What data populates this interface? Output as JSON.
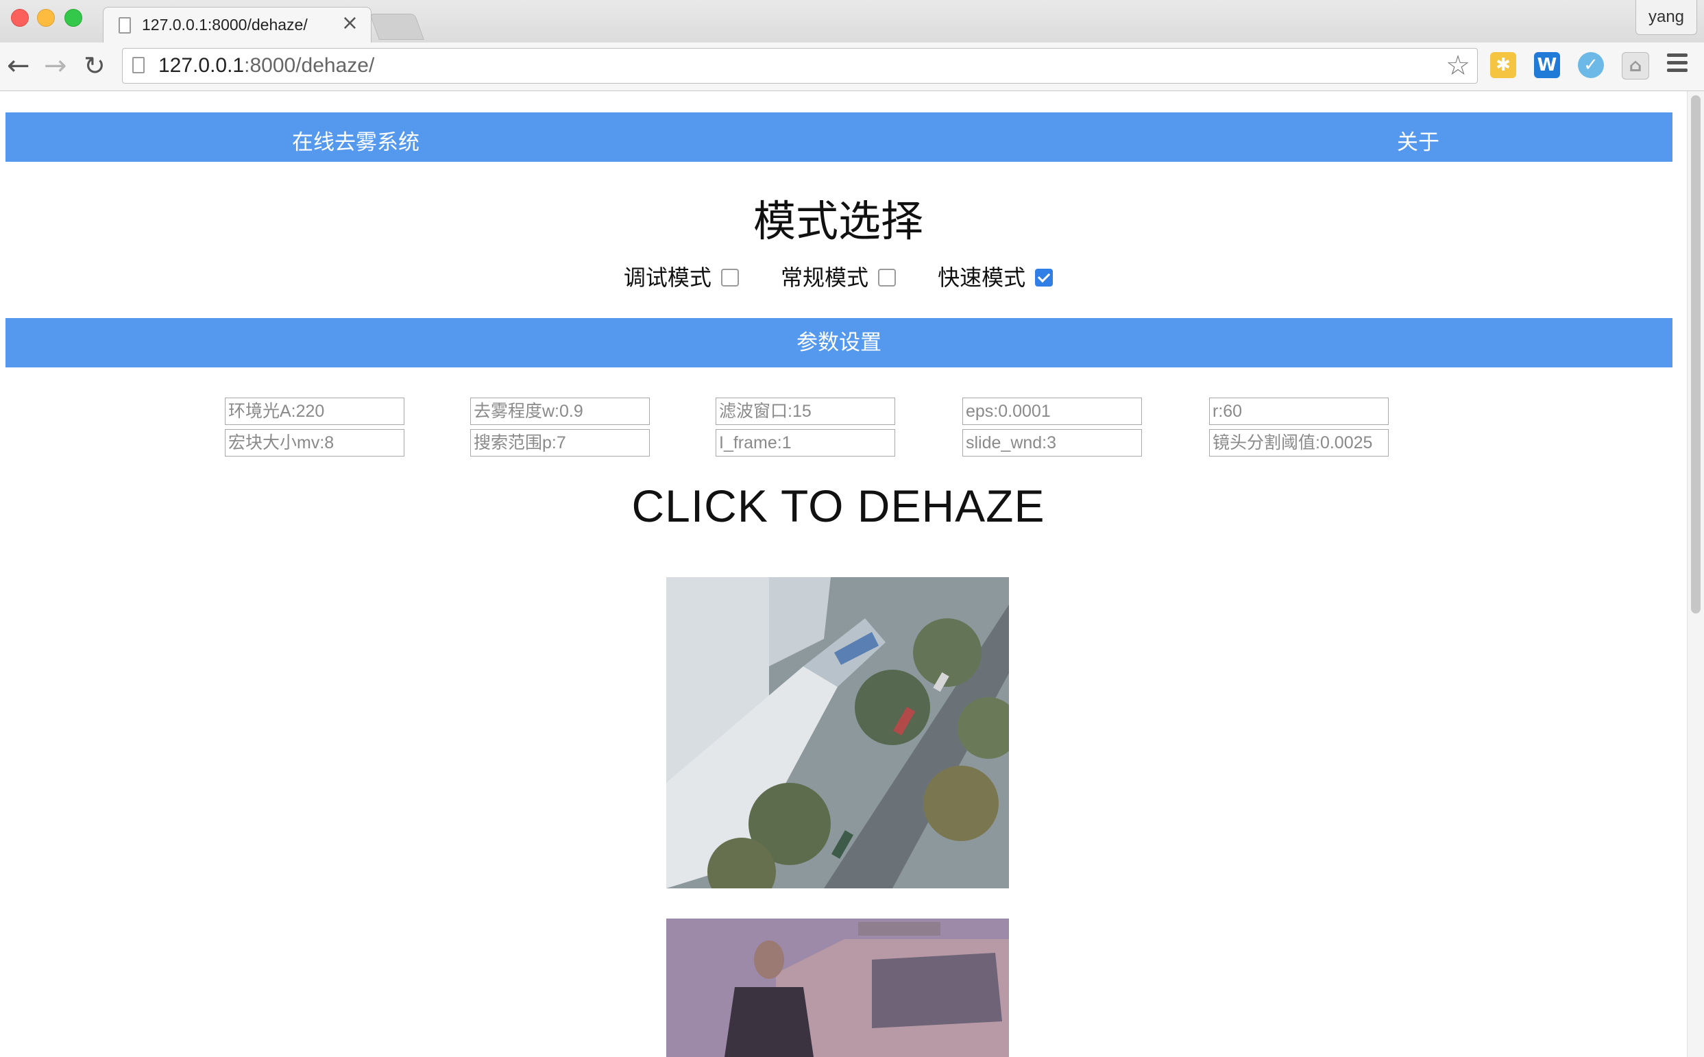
{
  "browser": {
    "tab_title": "127.0.0.1:8000/dehaze/",
    "tab_close": "×",
    "profile_name": "yang",
    "url_host": "127.0.0.1",
    "url_rest": ":8000/dehaze/",
    "star_icon": "☆",
    "back_icon": "←",
    "forward_icon": "→",
    "reload_icon": "↻",
    "extensions": [
      "✱",
      "W",
      "✓",
      "⌂"
    ]
  },
  "navbar": {
    "brand": "在线去雾系统",
    "about": "关于"
  },
  "mode_section": {
    "title": "模式选择",
    "modes": [
      {
        "label": "调试模式",
        "checked": false
      },
      {
        "label": "常规模式",
        "checked": false
      },
      {
        "label": "快速模式",
        "checked": true
      }
    ]
  },
  "params": {
    "header": "参数设置",
    "row1": [
      "环境光A:220",
      "去雾程度w:0.9",
      "滤波窗口:15",
      "eps:0.0001",
      "r:60"
    ],
    "row2": [
      "宏块大小mv:8",
      "搜索范围p:7",
      "I_frame:1",
      "slide_wnd:3",
      "镜头分割阈值:0.0025"
    ]
  },
  "action": {
    "title": "CLICK TO DEHAZE"
  },
  "colors": {
    "bar_blue": "#5599ee",
    "checkbox_blue": "#2f7fe6"
  }
}
